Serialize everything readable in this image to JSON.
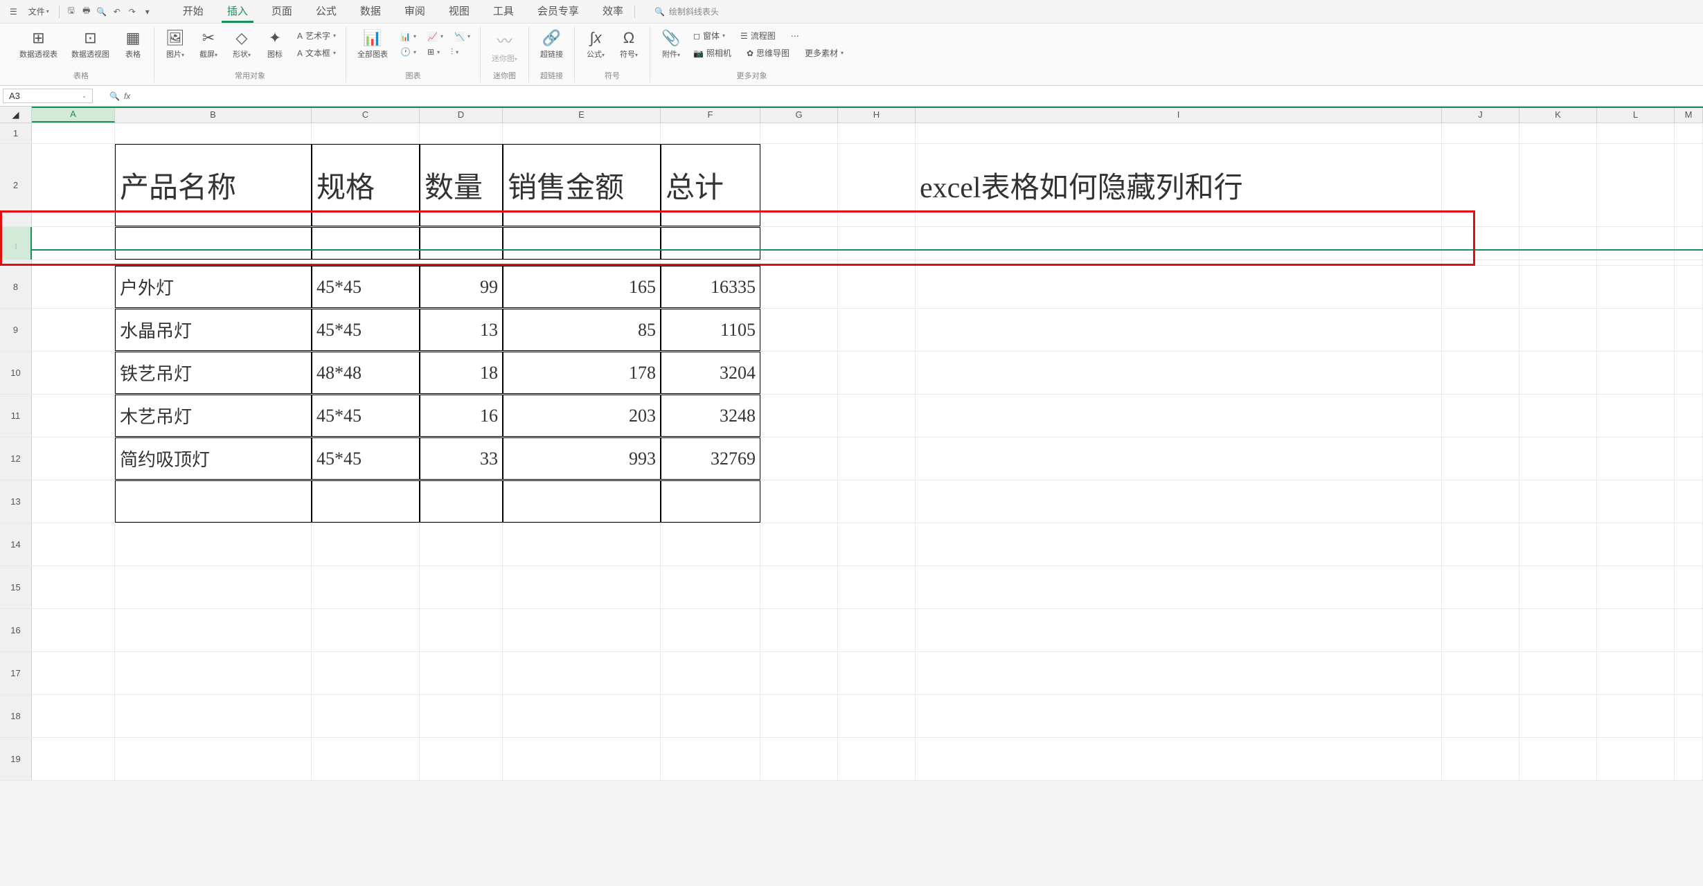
{
  "menubar": {
    "file": "文件",
    "search_placeholder": "绘制斜线表头"
  },
  "tabs": {
    "items": [
      "开始",
      "插入",
      "页面",
      "公式",
      "数据",
      "审阅",
      "视图",
      "工具",
      "会员专享",
      "效率"
    ],
    "active_idx": 1
  },
  "ribbon": {
    "groups": [
      {
        "label": "表格",
        "buttons": [
          {
            "icon": "⊞",
            "label": "数据透视表"
          },
          {
            "icon": "⊡",
            "label": "数据透视图"
          },
          {
            "icon": "▦",
            "label": "表格"
          }
        ]
      },
      {
        "label": "常用对象",
        "buttons": [
          {
            "icon": "🖼",
            "label": "图片",
            "drop": true
          },
          {
            "icon": "✂",
            "label": "截屏",
            "drop": true
          },
          {
            "icon": "◇",
            "label": "形状",
            "drop": true
          },
          {
            "icon": "✦",
            "label": "图标"
          }
        ],
        "side": [
          {
            "icon": "A",
            "label": "艺术字",
            "drop": true
          },
          {
            "icon": "A",
            "label": "文本框",
            "drop": true
          }
        ]
      },
      {
        "label": "图表",
        "buttons": [
          {
            "icon": "📊",
            "label": "全部图表"
          }
        ],
        "small_icons": [
          "📊",
          "📈",
          "📉",
          "🕐",
          "⊞",
          "⫶"
        ]
      },
      {
        "label": "迷你图",
        "buttons": [
          {
            "icon": "〰",
            "label": "迷你图",
            "drop": true,
            "disabled": true
          }
        ]
      },
      {
        "label": "超链接",
        "buttons": [
          {
            "icon": "🔗",
            "label": "超链接"
          }
        ]
      },
      {
        "label": "符号",
        "buttons": [
          {
            "icon": "∫x",
            "label": "公式",
            "drop": true
          },
          {
            "icon": "Ω",
            "label": "符号",
            "drop": true
          }
        ]
      },
      {
        "label": "更多对象",
        "buttons": [
          {
            "icon": "📎",
            "label": "附件",
            "drop": true
          }
        ],
        "side": [
          {
            "icon": "◻",
            "label": "窗体",
            "drop": true
          },
          {
            "icon": "📷",
            "label": "照相机"
          },
          {
            "icon": "☰",
            "label": "流程图"
          },
          {
            "icon": "✿",
            "label": "思维导图"
          },
          {
            "icon": "⋯",
            "label": "更多素材",
            "drop": true
          }
        ]
      }
    ]
  },
  "name_box": "A3",
  "columns": [
    "A",
    "B",
    "C",
    "D",
    "E",
    "F",
    "G",
    "H",
    "I",
    "J",
    "K",
    "L",
    "M"
  ],
  "data": {
    "header": [
      "产品名称",
      "规格",
      "数量",
      "销售金额",
      "总计"
    ],
    "note_i": "excel表格如何隐藏列和行",
    "rows": [
      {
        "num": "8",
        "b": "户外灯",
        "c": "45*45",
        "d": "99",
        "e": "165",
        "f": "16335"
      },
      {
        "num": "9",
        "b": "水晶吊灯",
        "c": "45*45",
        "d": "13",
        "e": "85",
        "f": "1105"
      },
      {
        "num": "10",
        "b": "铁艺吊灯",
        "c": "48*48",
        "d": "18",
        "e": "178",
        "f": "3204"
      },
      {
        "num": "11",
        "b": "木艺吊灯",
        "c": "45*45",
        "d": "16",
        "e": "203",
        "f": "3248"
      },
      {
        "num": "12",
        "b": "简约吸顶灯",
        "c": "45*45",
        "d": "33",
        "e": "993",
        "f": "32769"
      }
    ]
  },
  "visible_row_nums_before": [
    "1",
    "2"
  ],
  "visible_row_nums_after": [
    "13",
    "14",
    "15",
    "16",
    "17",
    "18",
    "19"
  ]
}
